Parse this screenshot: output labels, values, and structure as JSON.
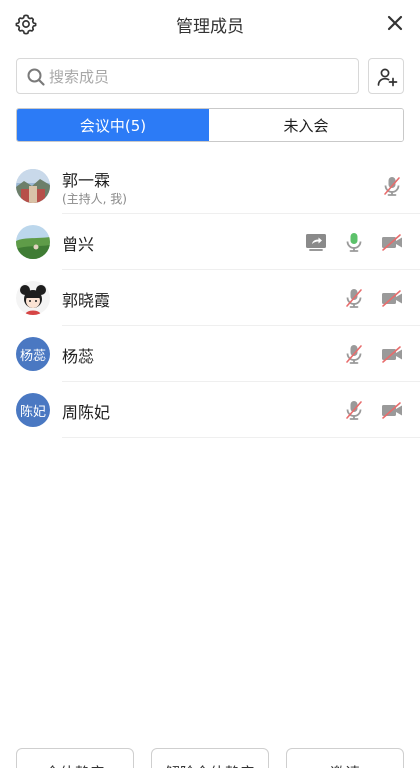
{
  "header": {
    "title": "管理成员"
  },
  "search": {
    "placeholder": "搜索成员",
    "value": ""
  },
  "tabs": [
    {
      "label": "会议中(5)",
      "active": true
    },
    {
      "label": "未入会",
      "active": false
    }
  ],
  "members": [
    {
      "name": "郭一霖",
      "subtitle": "(主持人, 我)",
      "avatar_text": "",
      "avatar_type": "landscape",
      "has_share": false,
      "mic": "muted",
      "camera": null
    },
    {
      "name": "曾兴",
      "subtitle": "",
      "avatar_text": "",
      "avatar_type": "field",
      "has_share": true,
      "mic": "on",
      "camera": "off"
    },
    {
      "name": "郭晓霞",
      "subtitle": "",
      "avatar_text": "",
      "avatar_type": "cartoon",
      "has_share": false,
      "mic": "muted",
      "camera": "off"
    },
    {
      "name": "杨蕊",
      "subtitle": "",
      "avatar_text": "杨蕊",
      "avatar_type": "text",
      "has_share": false,
      "mic": "muted",
      "camera": "off"
    },
    {
      "name": "周陈妃",
      "subtitle": "",
      "avatar_text": "陈妃",
      "avatar_type": "text",
      "has_share": false,
      "mic": "muted",
      "camera": "off"
    }
  ],
  "footer": {
    "mute_all": "全体静音",
    "unmute_all": "解除全体静音",
    "invite": "邀请"
  },
  "colors": {
    "accent": "#2c7bf6",
    "avatar_bg": "#4a78c2",
    "mic_on": "#5cc16a",
    "muted_slash": "#e86c6c"
  }
}
